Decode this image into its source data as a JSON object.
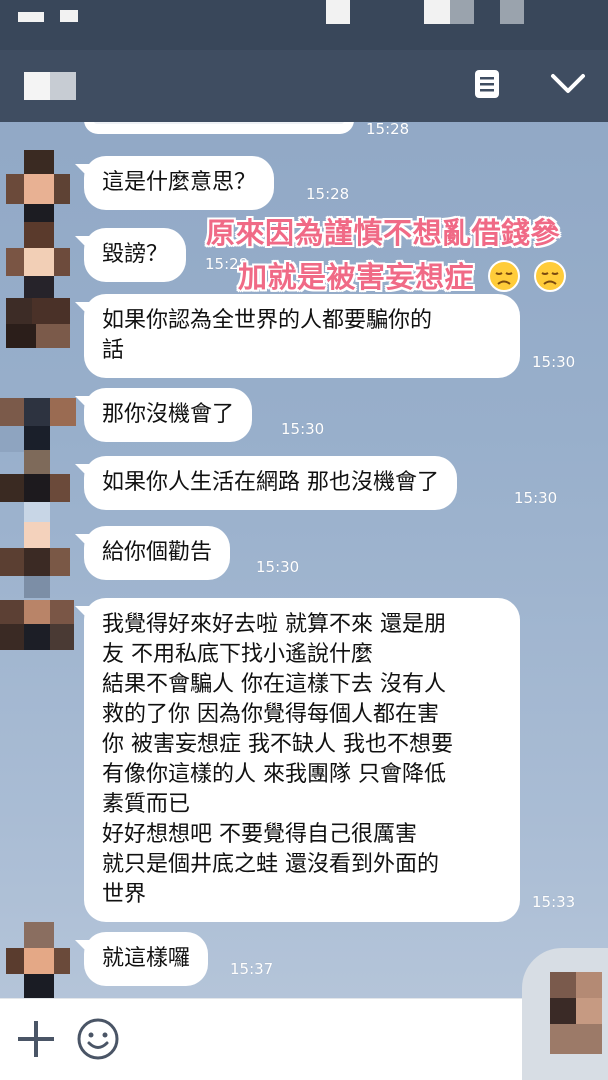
{
  "status_bar": {},
  "header": {
    "title_redacted": true,
    "menu_icon": "menu-list-icon",
    "collapse_icon": "chevron-down-icon"
  },
  "messages": [
    {
      "text": "這是什麼意思？",
      "time": "15:28"
    },
    {
      "text": "毀謗？",
      "time": "15:28"
    },
    {
      "text": "如果你認為全世界的人都要騙你的\n話",
      "time": "15:30"
    },
    {
      "text": "那你沒機會了",
      "time": "15:30"
    },
    {
      "text": "如果你人生活在網路 那也沒機會了",
      "time": "15:30"
    },
    {
      "text": "給你個勸告",
      "time": "15:30"
    },
    {
      "text": "我覺得好來好去啦 就算不來 還是朋\n友 不用私底下找小遙說什麼\n結果不會騙人 你在這樣下去 沒有人\n救的了你 因為你覺得每個人都在害\n你 被害妄想症 我不缺人 我也不想要\n有像你這樣的人 來我團隊 只會降低\n素質而已\n好好想想吧 不要覺得自己很厲害\n就只是個井底之蛙 還沒看到外面的\n世界",
      "time": "15:33"
    },
    {
      "text": "就這樣囉",
      "time": "15:37"
    }
  ],
  "top_clipped_time": "15:28",
  "overlay": {
    "line1": "原來因為謹慎不想亂借錢參",
    "line2": "加就是被害妄想症",
    "emoji": "disappointed-face-icon",
    "color": "#f06a86"
  },
  "input_bar": {
    "add_icon": "plus-icon",
    "emoji_icon": "smile-icon"
  },
  "colors": {
    "header": "#3f4d61",
    "status_bar": "#39475a",
    "chat_bg": "#98afcb",
    "bubble": "#ffffff"
  }
}
